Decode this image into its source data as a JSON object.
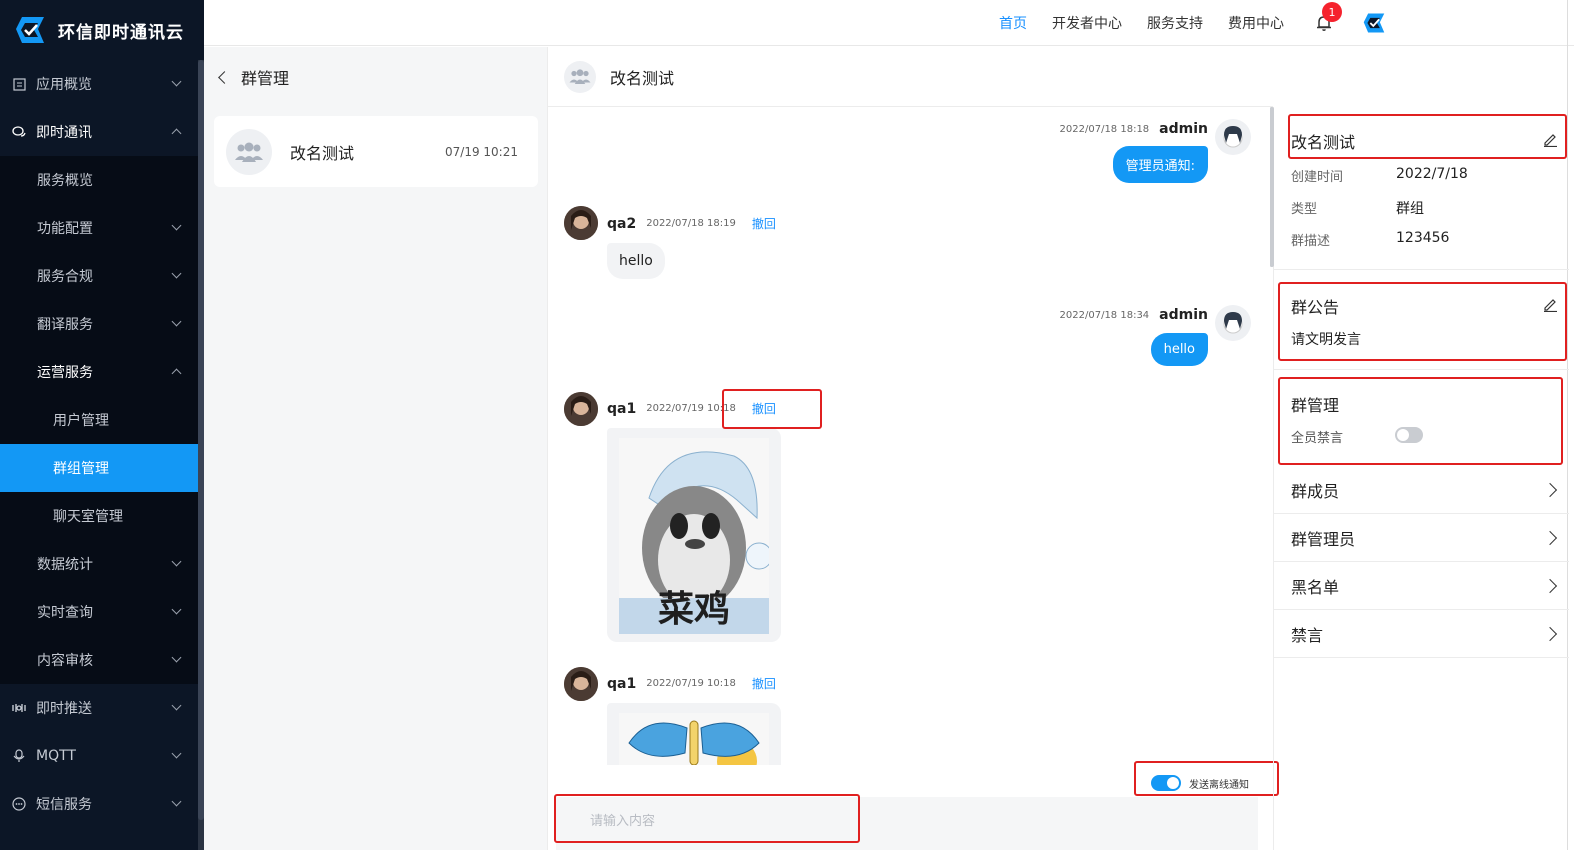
{
  "app": {
    "title": "环信即时通讯云"
  },
  "sidebar": {
    "items": [
      {
        "label": "应用概览",
        "icon": "overview-icon"
      },
      {
        "label": "即时通讯",
        "icon": "chat-bubbles-icon"
      },
      {
        "label": "服务概览"
      },
      {
        "label": "功能配置"
      },
      {
        "label": "服务合规"
      },
      {
        "label": "翻译服务"
      },
      {
        "label": "运营服务"
      },
      {
        "label": "用户管理"
      },
      {
        "label": "群组管理"
      },
      {
        "label": "聊天室管理"
      },
      {
        "label": "数据统计"
      },
      {
        "label": "实时查询"
      },
      {
        "label": "内容审核"
      },
      {
        "label": "即时推送",
        "icon": "push-icon"
      },
      {
        "label": "MQTT",
        "icon": "mqtt-icon"
      },
      {
        "label": "短信服务",
        "icon": "sms-icon"
      }
    ]
  },
  "topnav": {
    "home": "首页",
    "developer": "开发者中心",
    "support": "服务支持",
    "billing": "费用中心",
    "notification_count": "1"
  },
  "group_list": {
    "header": "群管理",
    "groups": [
      {
        "name": "改名测试",
        "time": "07/19 10:21"
      }
    ]
  },
  "chat": {
    "title": "改名测试",
    "messages": [
      {
        "side": "right",
        "time": "2022/07/18 18:18",
        "sender": "admin",
        "text": "管理员通知:"
      },
      {
        "side": "left",
        "time": "2022/07/18 18:19",
        "sender": "qa2",
        "text": "hello",
        "recall": "撤回"
      },
      {
        "side": "right",
        "time": "2022/07/18 18:34",
        "sender": "admin",
        "text": "hello"
      },
      {
        "side": "left",
        "time": "2022/07/19 10:18",
        "sender": "qa1",
        "recall": "撤回",
        "image": "菜鸡"
      },
      {
        "side": "left",
        "time": "2022/07/19 10:18",
        "sender": "qa1",
        "recall": "撤回",
        "image": ""
      }
    ],
    "offline_notice_label": "发送离线通知",
    "offline_notice_on": true,
    "input_placeholder": "请输入内容"
  },
  "info": {
    "group_name": "改名测试",
    "created_label": "创建时间",
    "created_value": "2022/7/18",
    "type_label": "类型",
    "type_value": "群组",
    "desc_label": "群描述",
    "desc_value": "123456",
    "announcement_title": "群公告",
    "announcement_text": "请文明发言",
    "manage_title": "群管理",
    "mute_all_label": "全员禁言",
    "mute_all_on": false,
    "links": [
      "群成员",
      "群管理员",
      "黑名单",
      "禁言"
    ]
  },
  "colors": {
    "sidebar_bg": "#0c1626",
    "accent": "#1398f5",
    "highlight": "#e02020"
  }
}
